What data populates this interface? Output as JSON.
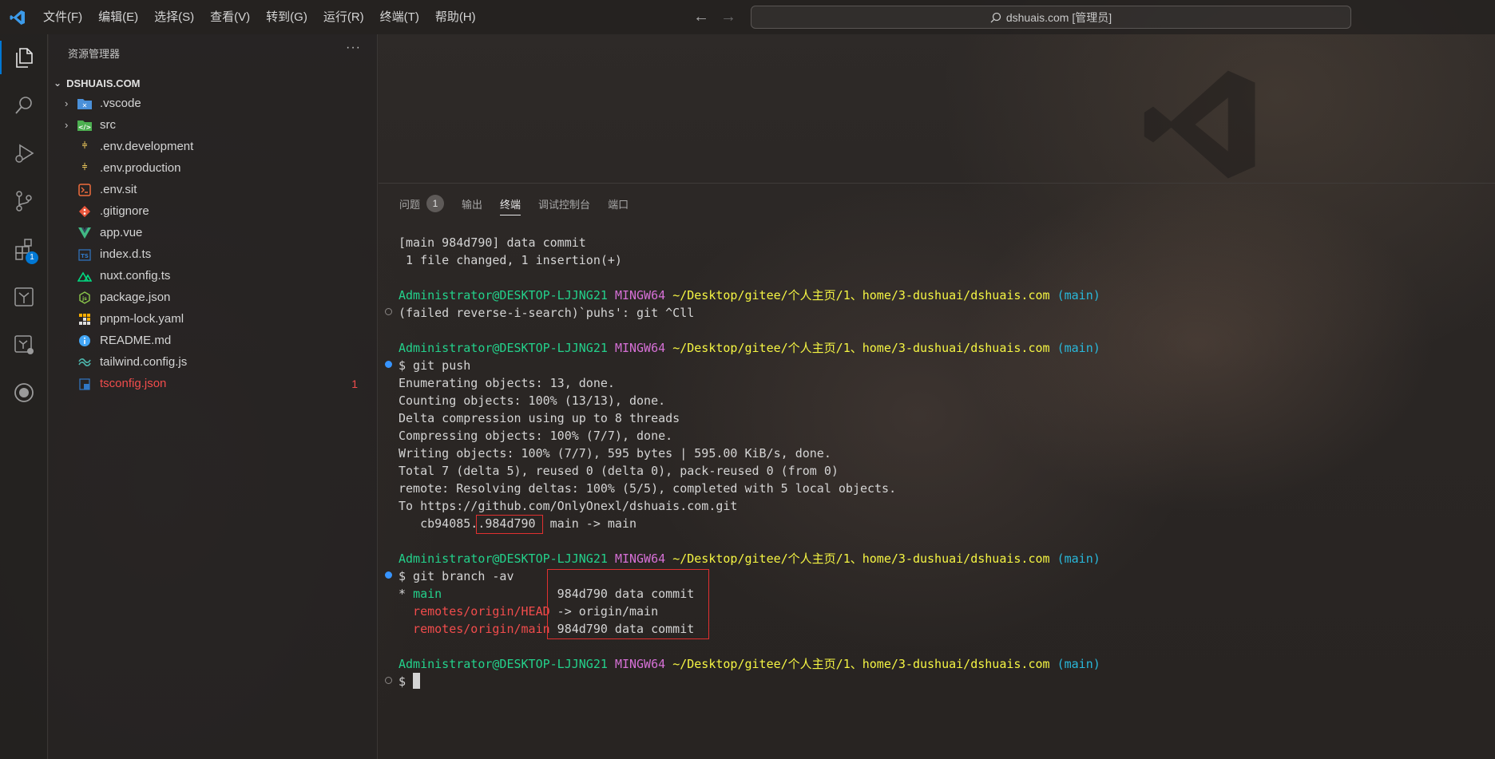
{
  "titlebar": {
    "menu": [
      "文件(F)",
      "编辑(E)",
      "选择(S)",
      "查看(V)",
      "转到(G)",
      "运行(R)",
      "终端(T)",
      "帮助(H)"
    ],
    "back_arrow": "←",
    "forward_arrow": "→",
    "command_center": "dshuais.com [管理员]"
  },
  "activitybar": {
    "extensions_badge": "1"
  },
  "sidebar": {
    "title": "资源管理器",
    "more": "···",
    "root": "DSHUAIS.COM",
    "items": [
      {
        "name": ".vscode",
        "icon": "folder-icon",
        "folder": true
      },
      {
        "name": "src",
        "icon": "folder-icon",
        "folder": true
      },
      {
        "name": ".env.development",
        "icon": "env-icon"
      },
      {
        "name": ".env.production",
        "icon": "env-icon"
      },
      {
        "name": ".env.sit",
        "icon": "terminal-file-icon"
      },
      {
        "name": ".gitignore",
        "icon": "git-icon"
      },
      {
        "name": "app.vue",
        "icon": "vue-icon"
      },
      {
        "name": "index.d.ts",
        "icon": "ts-icon"
      },
      {
        "name": "nuxt.config.ts",
        "icon": "nuxt-icon"
      },
      {
        "name": "package.json",
        "icon": "node-icon"
      },
      {
        "name": "pnpm-lock.yaml",
        "icon": "pnpm-icon"
      },
      {
        "name": "README.md",
        "icon": "info-icon"
      },
      {
        "name": "tailwind.config.js",
        "icon": "tailwind-icon"
      },
      {
        "name": "tsconfig.json",
        "icon": "tsconfig-icon",
        "error_count": "1"
      }
    ]
  },
  "panel": {
    "tabs": [
      {
        "label": "问题",
        "badge": "1"
      },
      {
        "label": "输出"
      },
      {
        "label": "终端",
        "active": true
      },
      {
        "label": "调试控制台"
      },
      {
        "label": "端口"
      }
    ]
  },
  "terminal": {
    "prompt_user": "Administrator@DESKTOP-LJJNG21",
    "prompt_env": "MINGW64",
    "prompt_path": "~/Desktop/gitee/个人主页/1、home/3-dushuai/dshuais.com",
    "prompt_branch": "(main)",
    "l1": "[main 984d790] data commit",
    "l2": " 1 file changed, 1 insertion(+)",
    "l4": "(failed reverse-i-search)`puhs': git ^Cll",
    "l6": "$ git push",
    "l7": "Enumerating objects: 13, done.",
    "l8": "Counting objects: 100% (13/13), done.",
    "l9": "Delta compression using up to 8 threads",
    "l10": "Compressing objects: 100% (7/7), done.",
    "l11": "Writing objects: 100% (7/7), 595 bytes | 595.00 KiB/s, done.",
    "l12": "Total 7 (delta 5), reused 0 (delta 0), pack-reused 0 (from 0)",
    "l13": "remote: Resolving deltas: 100% (5/5), completed with 5 local objects.",
    "l14": "To https://github.com/OnlyOnexl/dshuais.com.git",
    "l15": "   cb94085..984d790  main -> main",
    "l17": "$ git branch -av",
    "br1_star": "* ",
    "br1_name": "main",
    "br1_rest": "                984d790 data commit",
    "br2_name": "  remotes/origin/HEAD",
    "br2_rest": " -> origin/main",
    "br3_name": "  remotes/origin/main",
    "br3_rest": " 984d790 data commit",
    "last_prompt": "$ "
  }
}
